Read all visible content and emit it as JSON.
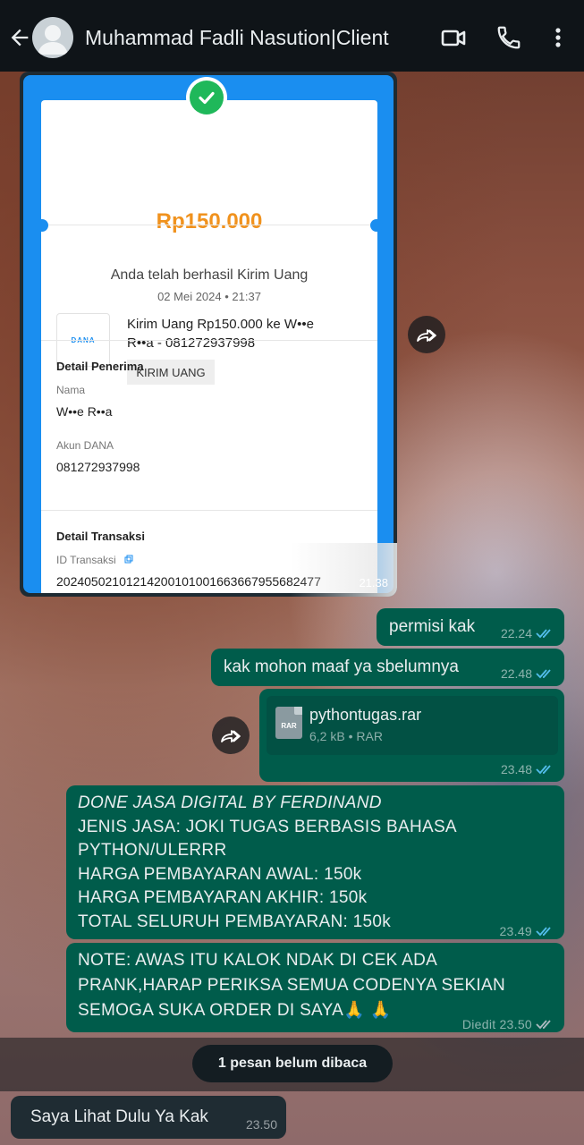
{
  "header": {
    "contact_name": "Muhammad Fadli Nasution|Client"
  },
  "receipt": {
    "amount": "Rp150.000",
    "status": "Anda telah berhasil Kirim Uang",
    "date": "02 Mei 2024 • 21:37",
    "logo_text": "DANA",
    "transaction_line1": "Kirim Uang Rp150.000 ke W••e",
    "transaction_line2": "R••a - 081272937998",
    "tag": "KIRIM UANG",
    "recipient_heading": "Detail Penerima",
    "name_label": "Nama",
    "name_value": "W••e R••a",
    "account_label": "Akun DANA",
    "account_value": "081272937998",
    "transaction_heading": "Detail Transaksi",
    "id_label": "ID Transaksi",
    "id_value": "20240502101214200101001663667955682477",
    "time": "21.38"
  },
  "messages": [
    {
      "direction": "outgoing",
      "text": "permisi kak",
      "time": "22.24"
    },
    {
      "direction": "outgoing",
      "text": "kak mohon maaf ya sbelumnya",
      "time": "22.48"
    },
    {
      "direction": "outgoing",
      "type": "file",
      "file_name": "pythontugas.rar",
      "file_meta": "6,2 kB • RAR",
      "icon_label": "RAR",
      "time": "23.48"
    },
    {
      "direction": "outgoing",
      "line1": "DONE JASA DIGITAL BY FERDINAND",
      "line2": "JENIS JASA: JOKI TUGAS BERBASIS BAHASA",
      "line3": "PYTHON/ULERRR",
      "line4": "HARGA PEMBAYARAN AWAL: 150k",
      "line5": "HARGA PEMBAYARAN AKHIR: 150k",
      "line6": "TOTAL SELURUH PEMBAYARAN: 150k",
      "time": "23.49"
    },
    {
      "direction": "outgoing",
      "line1": "NOTE: AWAS ITU KALOK NDAK DI CEK ADA",
      "line2": "PRANK,HARAP PERIKSA SEMUA CODENYA SEKIAN",
      "line3": "SEMOGA SUKA ORDER DI SAYA🙏 🙏",
      "edited_label": "Diedit",
      "time": "23.50"
    }
  ],
  "unread_banner": "1 pesan belum dibaca",
  "incoming_message": {
    "text": "Saya Lihat Dulu Ya Kak",
    "time": "23.50"
  }
}
